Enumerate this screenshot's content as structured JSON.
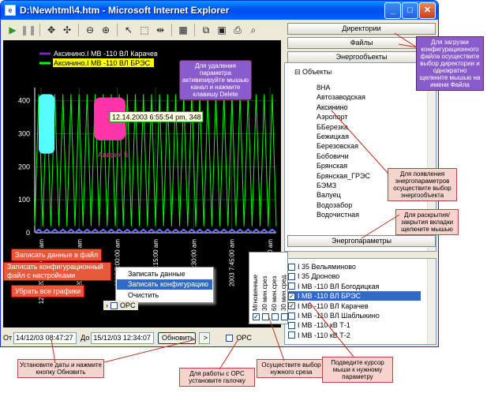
{
  "window": {
    "title": "D:\\Newhtml\\4.htm - Microsoft Internet Explorer"
  },
  "panel": {
    "dirs": "Директории",
    "files": "Файлы",
    "objects": "Энергообъекты",
    "params": "Энергопараметры"
  },
  "tree": {
    "root": "Объекты",
    "items": [
      "8НА",
      "Автозаводская",
      "Аксинино",
      "Аэропорт",
      "ББерезка",
      "Бежицкая",
      "Березовская",
      "Бобовичи",
      "Брянская",
      "Брянская_ГРЭС",
      "БЭМЗ",
      "Валуец",
      "Водозабор",
      "Водочистная"
    ]
  },
  "params": [
    {
      "label": "I 35 Вельяминово",
      "checked": false
    },
    {
      "label": "I 35 Дроново",
      "checked": false
    },
    {
      "label": "I МВ -110 ВЛ Богодицкая",
      "checked": false
    },
    {
      "label": "I МВ -110 ВЛ БРЭС",
      "checked": true
    },
    {
      "label": "I МВ -110 ВЛ Карачев",
      "checked": true
    },
    {
      "label": "I МВ -110 ВЛ Шаблыкино",
      "checked": false
    },
    {
      "label": "I МВ -110 кВ Т-1",
      "checked": false
    },
    {
      "label": "I МВ -110 кВ Т-2",
      "checked": false
    }
  ],
  "legend": [
    {
      "name": "Аксинино.I МВ -110 ВЛ Карачев",
      "color": "#6b2fbf"
    },
    {
      "name": "Аксинино.I МВ -110 ВЛ БРЭС",
      "color": "#00ff00"
    }
  ],
  "chart_data": {
    "type": "line",
    "title": "",
    "ylim": [
      0,
      440
    ],
    "yticks": [
      "0",
      "100",
      "200",
      "300",
      "400"
    ],
    "xticks": [
      "12.14.2003 6:30:00 am",
      "2003 6:45:00 am",
      "2003 7:00:00 am",
      "2003 7:15:00 am",
      "2003 7:30:00 am",
      "2003 7:45:00 am",
      "12.15.2003 8:00:00 am"
    ],
    "tooltip": "12.14.2003 6:55:54 pm, 348",
    "annotation": "Авария 5",
    "series": [
      {
        "name": "Аксинино.I МВ -110 ВЛ Карачев",
        "values": [
          0,
          10,
          0,
          10,
          0,
          10,
          0
        ]
      },
      {
        "name": "Аксинино.I МВ -110 ВЛ БРЭС",
        "values": [
          20,
          420,
          20,
          420,
          20,
          420,
          20
        ]
      }
    ]
  },
  "context_menu": [
    "Записать данные",
    "Записать конфигурацию",
    "Очистить"
  ],
  "bottom": {
    "from_label": "От",
    "from": "14/12/03 08:47:27",
    "to_label": "До",
    "to": "15/12/03 12:34:07",
    "refresh": "Обновить",
    "arrow": ">",
    "opc": "OPC"
  },
  "slices": [
    "Мгновенные",
    "30 мин.срез",
    "60 мин.срез",
    "30 мин.сред."
  ],
  "callouts": {
    "dirs": "Для загрузки конфигурационного файла осуществите выбор директории и однократно щелкните мышью на имени Файла",
    "delete": "Для удаления параметра активизируйте мышью канал и нажмите клавишу Delete",
    "energyobj": "Для появления энергопараметров осуществите выбор энергообъекта",
    "tabs": "Для раскрытия/закрытия вкладки щелкните мышью",
    "save_data": "Записать данные в файл",
    "save_config": "Записать конфигурационный файл с настройками",
    "clear": "Убрать все графики",
    "dates": "Установите даты и нажмите кнопку Обновить",
    "opc": "Для работы с OPC установите галочку",
    "slice": "Осуществите выбор нужного среза",
    "cursor": "Подведите курсор мыши к нужному параметру"
  },
  "toolbar_icons": [
    "play-icon",
    "pause-icon",
    "move-icon",
    "crosshair-icon",
    "zoom-out-icon",
    "zoom-in-icon",
    "pointer-icon",
    "select-rect-icon",
    "split-icon",
    "properties-icon",
    "copy-icon",
    "save-icon",
    "print-icon",
    "print-preview-icon"
  ]
}
